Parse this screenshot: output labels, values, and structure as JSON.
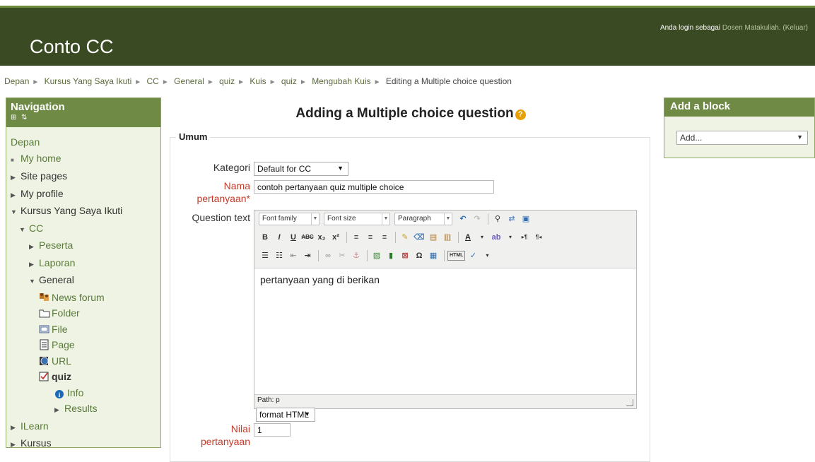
{
  "header": {
    "site_name": "Conto CC",
    "login_prefix": "Anda login sebagai",
    "user_name": "Dosen Matakuliah.",
    "logout": "(Keluar)"
  },
  "breadcrumb": [
    "Depan",
    "Kursus Yang Saya Ikuti",
    "CC",
    "General",
    "quiz",
    "Kuis",
    "quiz",
    "Mengubah Kuis",
    "Editing a Multiple choice question"
  ],
  "nav": {
    "title": "Navigation",
    "controls": "⊞ ⇅",
    "items": {
      "depan": "Depan",
      "my_home": "My home",
      "site_pages": "Site pages",
      "my_profile": "My profile",
      "kursus_saya": "Kursus Yang Saya Ikuti",
      "cc": "CC",
      "peserta": "Peserta",
      "laporan": "Laporan",
      "general": "General",
      "news_forum": "News forum",
      "folder": "Folder",
      "file": "File",
      "page": "Page",
      "url": "URL",
      "quiz": "quiz",
      "info": "Info",
      "results": "Results",
      "ilearn": "ILearn",
      "kursus": "Kursus"
    }
  },
  "main": {
    "title": "Adding a Multiple choice question",
    "section": "Umum",
    "kategori_label": "Kategori",
    "kategori_value": "Default for CC",
    "nama_label_1": "Nama",
    "nama_label_2": "pertanyaan*",
    "nama_value": "contoh pertanyaan quiz multiple choice",
    "qtext_label": "Question text",
    "editor": {
      "font_family": "Font family",
      "font_size": "Font size",
      "paragraph": "Paragraph",
      "content": "pertanyaan yang di berikan",
      "path": "Path: p"
    },
    "format_value": "format HTML",
    "nilai_label_1": "Nilai",
    "nilai_label_2": "pertanyaan",
    "nilai_value": "1"
  },
  "addblock": {
    "title": "Add a block",
    "select": "Add..."
  }
}
